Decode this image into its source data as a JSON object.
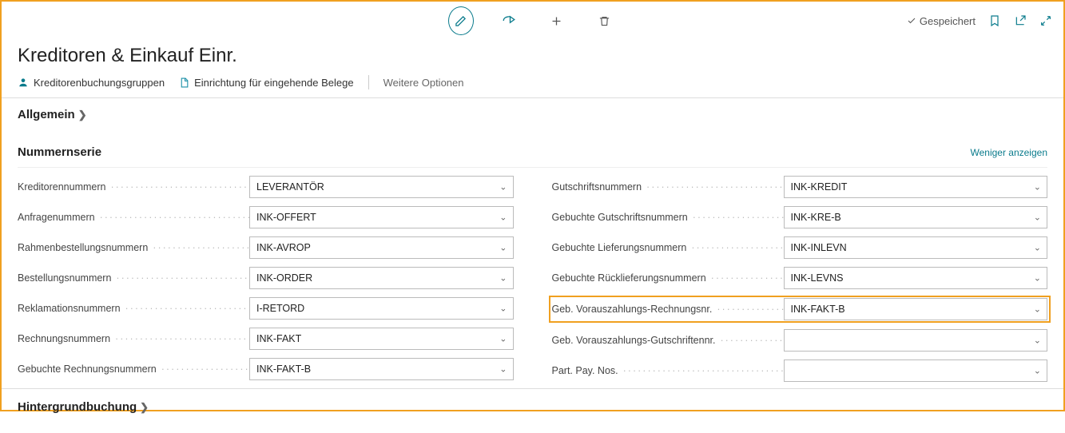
{
  "header": {
    "saved_label": "Gespeichert",
    "title": "Kreditoren & Einkauf Einr."
  },
  "commands": {
    "posting_groups": "Kreditorenbuchungsgruppen",
    "incoming_docs": "Einrichtung für eingehende Belege",
    "more_options": "Weitere Optionen"
  },
  "sections": {
    "general": "Allgemein",
    "number_series": "Nummernserie",
    "show_less": "Weniger anzeigen",
    "background_posting": "Hintergrundbuchung"
  },
  "fields": {
    "left": [
      {
        "label": "Kreditorennummern",
        "value": "LEVERANTÖR"
      },
      {
        "label": "Anfragenummern",
        "value": "INK-OFFERT"
      },
      {
        "label": "Rahmenbestellungsnummern",
        "value": "INK-AVROP"
      },
      {
        "label": "Bestellungsnummern",
        "value": "INK-ORDER"
      },
      {
        "label": "Reklamationsnummern",
        "value": "I-RETORD"
      },
      {
        "label": "Rechnungsnummern",
        "value": "INK-FAKT"
      },
      {
        "label": "Gebuchte Rechnungsnummern",
        "value": "INK-FAKT-B"
      }
    ],
    "right": [
      {
        "label": "Gutschriftsnummern",
        "value": "INK-KREDIT"
      },
      {
        "label": "Gebuchte Gutschriftsnummern",
        "value": "INK-KRE-B"
      },
      {
        "label": "Gebuchte Lieferungsnummern",
        "value": "INK-INLEVN"
      },
      {
        "label": "Gebuchte Rücklieferungsnummern",
        "value": "INK-LEVNS"
      },
      {
        "label": "Geb. Vorauszahlungs-Rechnungsnr.",
        "value": "INK-FAKT-B",
        "highlight": true
      },
      {
        "label": "Geb. Vorauszahlungs-Gutschriftennr.",
        "value": ""
      },
      {
        "label": "Part. Pay. Nos.",
        "value": ""
      }
    ]
  }
}
